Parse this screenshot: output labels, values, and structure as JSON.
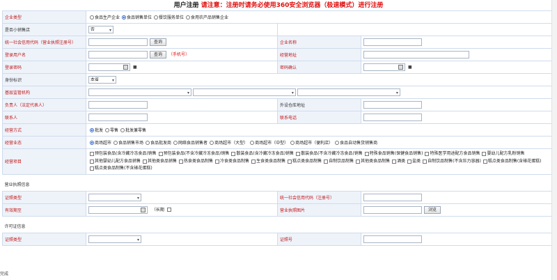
{
  "header": {
    "title": "用户注册",
    "notice": "请注意：注册时请务必使用360安全浏览器（极速模式）进行注册"
  },
  "enterprise_type": {
    "label": "企业类型",
    "options": [
      "食品生产企业",
      "食品销售单位",
      "餐饮服务单位",
      "食用农产品销售企业"
    ],
    "selected_index": 1
  },
  "small_workshop": {
    "label": "是否小销售店",
    "value": "否"
  },
  "credit_code": {
    "label": "统一社会信用代码（营业执照注册号）",
    "button": "查询"
  },
  "company_name": {
    "label": "企业名称"
  },
  "login_user": {
    "label": "登录用户名",
    "button": "查询",
    "hint": "（手机号）"
  },
  "business_address": {
    "label": "经营地址"
  },
  "password": {
    "label": "登录密码"
  },
  "password_confirm": {
    "label": "密码确认"
  },
  "identity": {
    "label": "身份标识",
    "value": "本省"
  },
  "supervision": {
    "label": "基层监管机构"
  },
  "legal_person": {
    "label": "负责人（法定代表人）"
  },
  "other_address": {
    "label": "外设仓库地址"
  },
  "contact": {
    "label": "联系人"
  },
  "contact_phone": {
    "label": "联系电话"
  },
  "business_mode": {
    "label": "经营方式",
    "options": [
      "批发",
      "零售",
      "批发兼零售"
    ],
    "selected_index": 0
  },
  "business_format": {
    "label": "经营业态",
    "options": [
      "商场超市",
      "食品销售市场",
      "食品批发商",
      "网络食品销售者",
      "商场超市（大型）",
      "商场超市（中型）",
      "商场超市（便利店）",
      "食品自动售货销售商"
    ],
    "selected_index": 0
  },
  "business_items": {
    "label": "经营项目",
    "items": [
      "预包装食品(含冷藏冷冻食品)销售",
      "预包装食品(不含冷藏冷冻食品)销售",
      "散装食品(含冷藏冷冻食品)销售",
      "散装食品(不含冷藏冷冻食品)销售",
      "特殊食品销售(保健食品销售)",
      "特殊医学用途配方食品销售",
      "婴幼儿配方乳粉销售",
      "其他婴幼儿配方食品销售",
      "其他类食品销售",
      "热食类食品制售",
      "冷食类食品制售",
      "生食类食品制售",
      "糕点类食品制售",
      "自制饮品制售",
      "其他类食品制售",
      "酒类",
      "盐类",
      "自制饮品制售(不含压力容器)",
      "糕点类食品制售(含裱花蛋糕)",
      "糕点类食品制售(不含裱花蛋糕)"
    ]
  },
  "license_section": {
    "title": "营业执照信息"
  },
  "license_type": {
    "label": "证照类型"
  },
  "license_credit_code": {
    "label": "统一社会信用代码（注册号）"
  },
  "validity": {
    "label": "有效期至",
    "long_term": "（长期"
  },
  "license_image": {
    "label": "营业执照图片",
    "button": "浏览"
  },
  "permit_section": {
    "title": "许可证信息"
  },
  "permit_type": {
    "label": "证照类型"
  },
  "permit_no": {
    "label": "证照号"
  },
  "footer_text": "完成"
}
